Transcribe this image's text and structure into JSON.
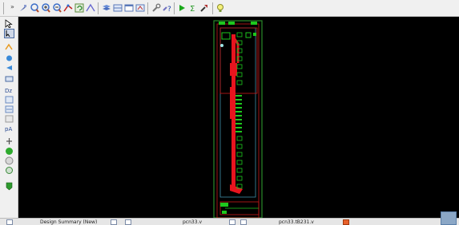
{
  "toolbar": {
    "buttons": [
      {
        "icon": "pin-icon"
      },
      {
        "icon": "zoom-fit-icon"
      },
      {
        "icon": "zoom-in-icon"
      },
      {
        "icon": "zoom-out-icon"
      },
      {
        "icon": "route-icon"
      },
      {
        "icon": "refresh-icon"
      },
      {
        "icon": "measure-icon"
      },
      {
        "icon": "layers-icon"
      },
      {
        "icon": "grid-icon"
      },
      {
        "icon": "window-icon"
      },
      {
        "icon": "probe-icon"
      },
      {
        "icon": "help-icon"
      },
      {
        "icon": "run-icon"
      },
      {
        "icon": "sum-icon"
      },
      {
        "icon": "tool-icon"
      },
      {
        "icon": "bulb-icon"
      }
    ]
  },
  "left_tools": [
    "select-icon",
    "cursor-icon",
    "highlight-icon",
    "move-icon",
    "zoom-tool-icon",
    "layer-icon",
    "instance-icon",
    "net-icon",
    "report-icon",
    "ruler-icon",
    "mark-icon",
    "place-icon",
    "add-icon",
    "delete-icon",
    "probe-tool-icon",
    "flag-icon"
  ],
  "statusbar": {
    "tabs": [
      {
        "label": "Design Summary (New)"
      },
      {
        "label": "pcn33.v"
      },
      {
        "label": "pcn33.tB231.v"
      }
    ]
  },
  "colors": {
    "background": "#000000",
    "wire_red": "#e8141e",
    "cell_green": "#1ec81e",
    "boundary_cyan": "#3f8fa8"
  }
}
